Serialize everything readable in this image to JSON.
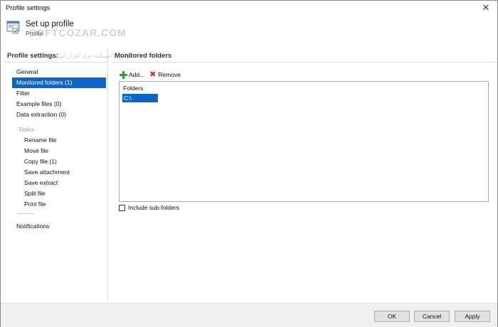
{
  "window": {
    "title": "Profile settings"
  },
  "header": {
    "title": "Set up profile",
    "subtitle": "Profile",
    "watermark": "SOFTCOZAR.COM",
    "watermark_ar": "اولین دانشنامه نرم افزار ایران"
  },
  "left_panel": {
    "title": "Profile settings:",
    "items": [
      {
        "label": "General",
        "selected": false
      },
      {
        "label": "Monitored folders (1)",
        "selected": true
      },
      {
        "label": "Filter",
        "selected": false
      },
      {
        "label": "Example files (0)",
        "selected": false
      },
      {
        "label": "Data extraction (0)",
        "selected": false
      }
    ],
    "tasks_heading": "-Tasks-",
    "tasks": [
      {
        "label": "Rename file"
      },
      {
        "label": "Move file"
      },
      {
        "label": "Copy file (1)"
      },
      {
        "label": "Save attachment"
      },
      {
        "label": "Save extract"
      },
      {
        "label": "Split file"
      },
      {
        "label": "Print file"
      }
    ],
    "notifications": "Notifications"
  },
  "right_panel": {
    "title": "Monitored folders",
    "toolbar": {
      "add_label": "Add...",
      "remove_label": "Remove"
    },
    "list": {
      "column_header": "Folders",
      "rows": [
        {
          "path": "C:\\",
          "selected": true
        }
      ]
    },
    "include_subfolders": {
      "label": "Include sub-folders",
      "checked": false
    }
  },
  "buttons": {
    "ok": "OK",
    "cancel": "Cancel",
    "apply": "Apply"
  },
  "colors": {
    "selection": "#0a66c8",
    "add_icon": "#2e9a3e",
    "remove_icon": "#d7301f"
  }
}
